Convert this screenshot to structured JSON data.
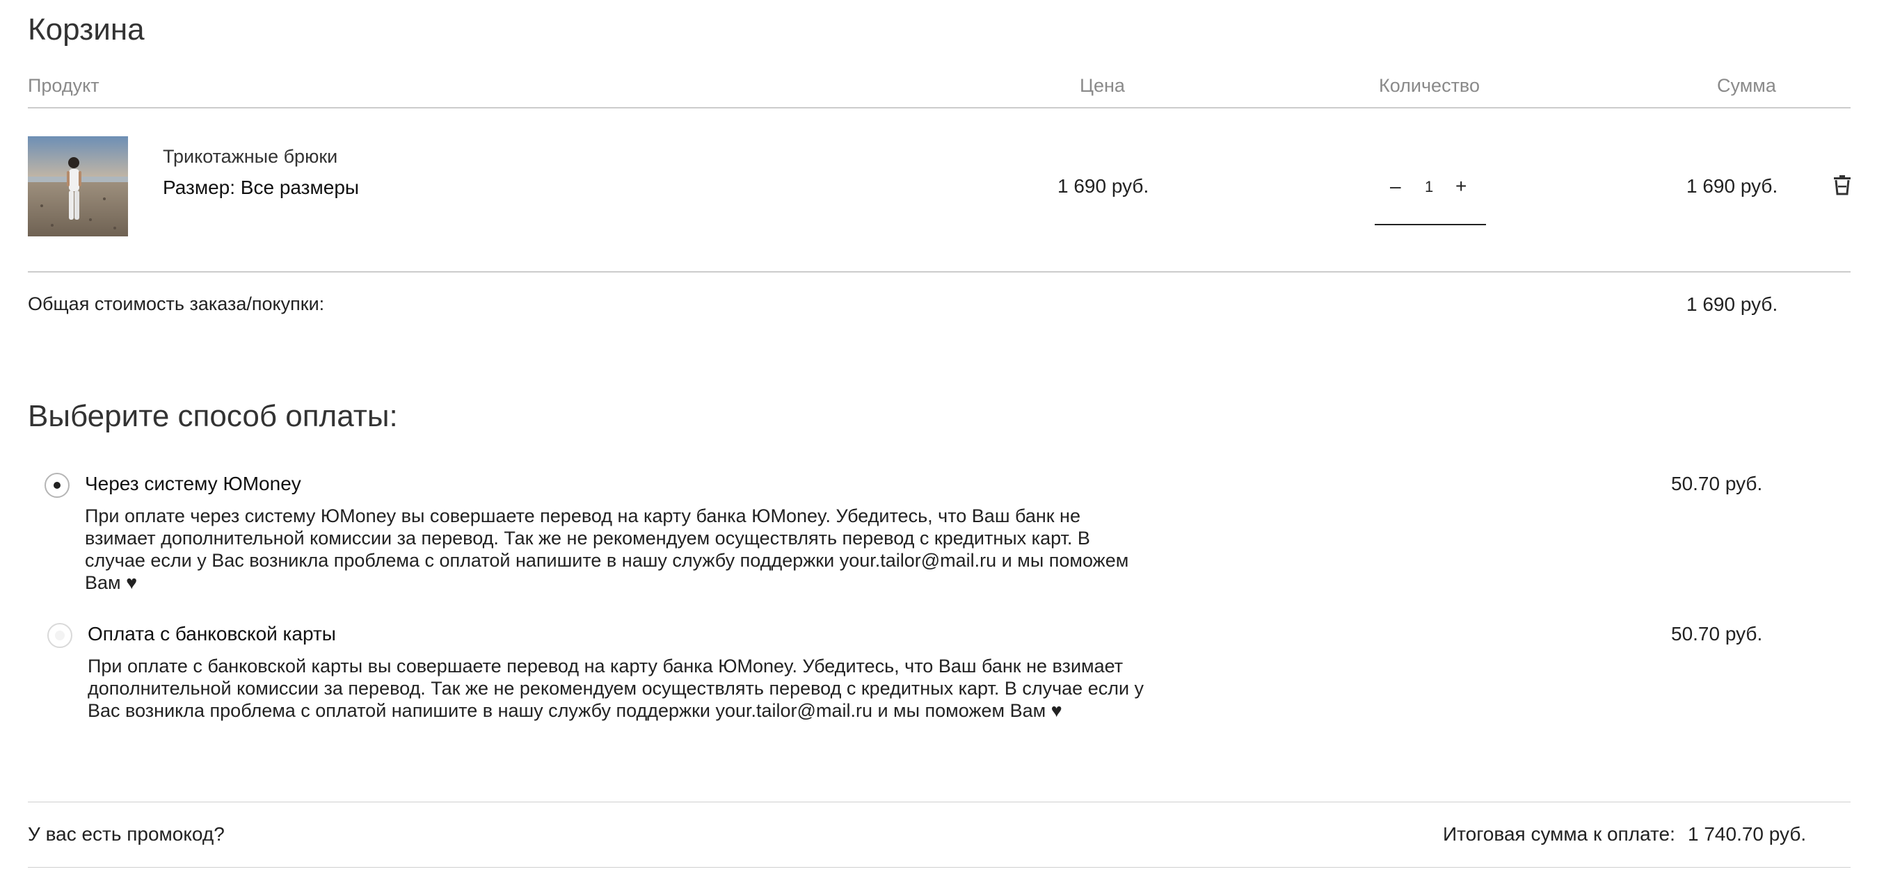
{
  "cart": {
    "title": "Корзина",
    "columns": {
      "product": "Продукт",
      "price": "Цена",
      "quantity": "Количество",
      "sum": "Сумма"
    },
    "items": [
      {
        "name": "Трикотажные брюки",
        "size_label": "Размер:",
        "size_value": "Все размеры",
        "price": "1 690 руб.",
        "quantity": "1",
        "sum": "1 690 руб.",
        "minus": "–",
        "plus": "+"
      }
    ],
    "total_label": "Общая стоимость заказа/покупки:",
    "total_value": "1 690 руб."
  },
  "payment": {
    "title": "Выберите способ оплаты:",
    "options": [
      {
        "label": "Через систему ЮMoney",
        "fee": "50.70 руб.",
        "selected": true,
        "description": "При оплате через систему ЮMoney вы совершаете перевод на карту банка ЮMoney. Убедитесь, что Ваш банк не взимает дополнительной комиссии за перевод. Так же не рекомендуем осуществлять перевод с кредитных карт. В случае если у Вас возникла проблема с оплатой напишите в нашу службу поддержки your.tailor@mail.ru и мы поможем Вам ♥"
      },
      {
        "label": "Оплата с банковской карты",
        "fee": "50.70 руб.",
        "selected": false,
        "description": "При оплате с банковской карты вы совершаете перевод на карту банка ЮMoney. Убедитесь, что Ваш банк не взимает дополнительной комиссии за перевод. Так же не рекомендуем осуществлять перевод с кредитных карт. В случае если у Вас возникла проблема с оплатой напишите в нашу службу поддержки your.tailor@mail.ru и мы поможем Вам ♥"
      }
    ]
  },
  "footer": {
    "promo_link": "У вас есть промокод?",
    "grand_total_label": "Итоговая сумма к оплате:",
    "grand_total_value": "1 740.70 руб."
  },
  "icons": {
    "delete": "trash-icon",
    "radio_selected": "radio-checked-icon",
    "radio_unselected": "radio-unchecked-icon"
  },
  "colors": {
    "text": "#222222",
    "muted": "#8a8a8a",
    "divider": "#cccccc"
  }
}
